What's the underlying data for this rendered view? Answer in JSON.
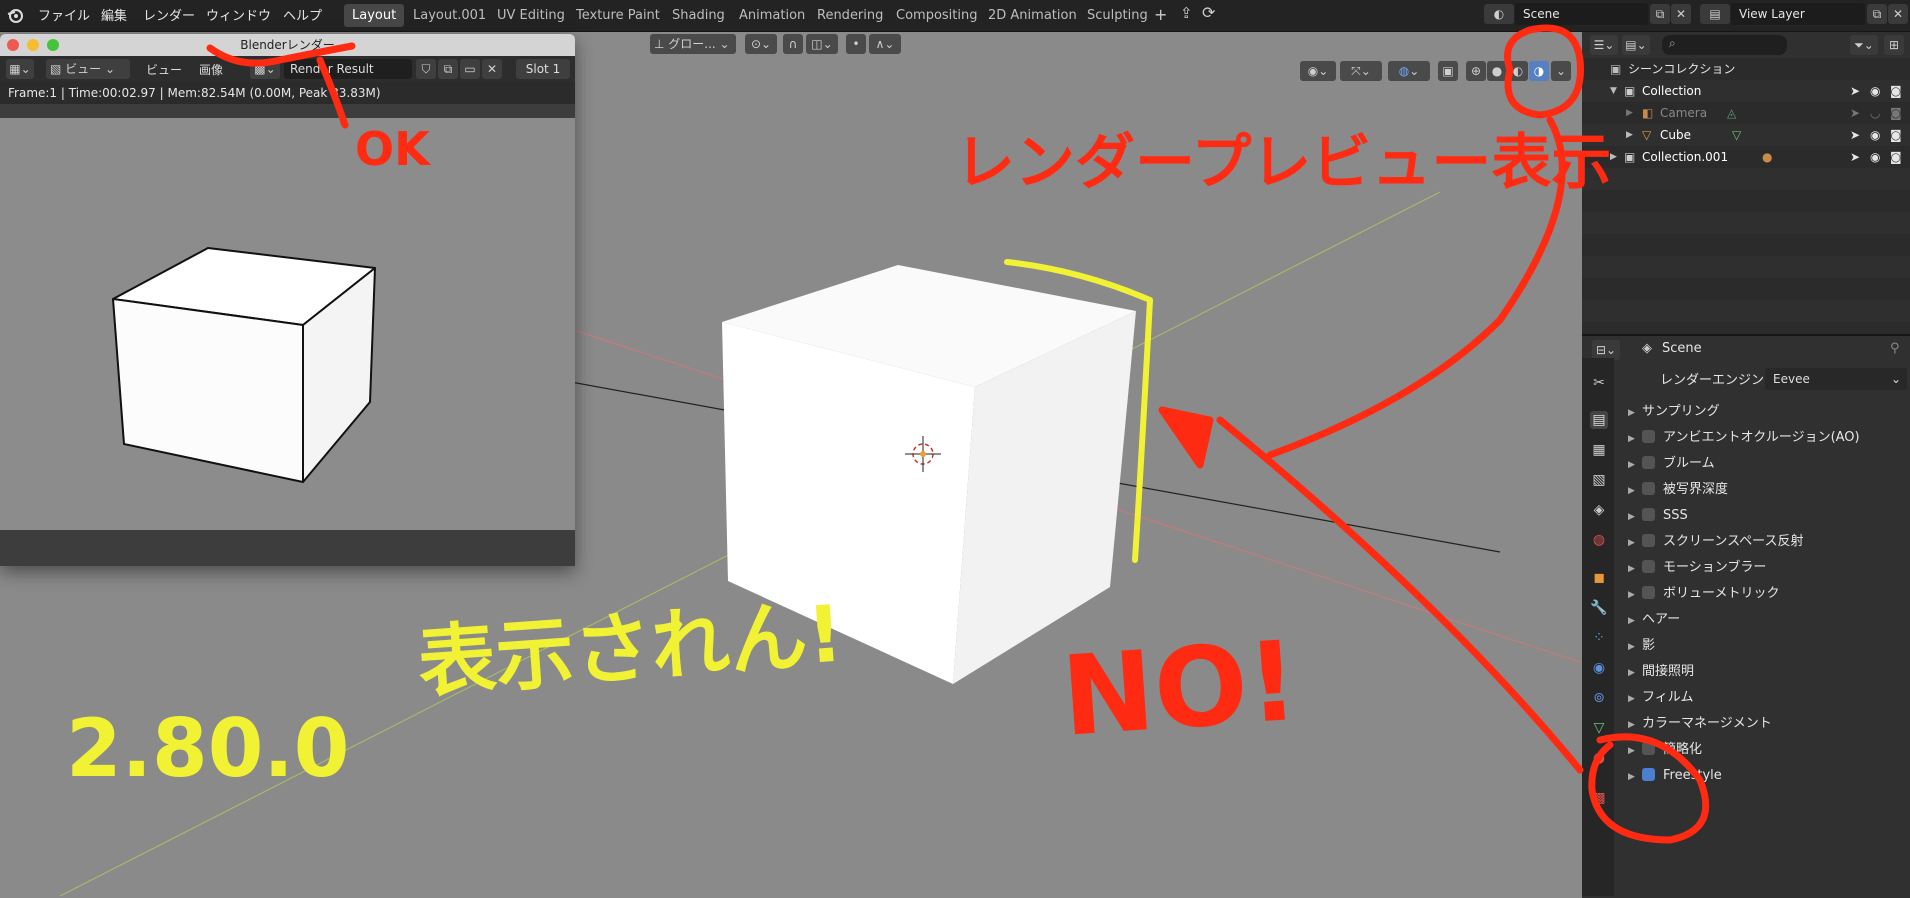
{
  "menu": [
    "ファイル",
    "編集",
    "レンダー",
    "ウィンドウ",
    "ヘルプ"
  ],
  "workspaces": [
    "Layout",
    "Layout.001",
    "UV Editing",
    "Texture Paint",
    "Shading",
    "Animation",
    "Rendering",
    "Compositing",
    "2D Animation",
    "Sculpting"
  ],
  "active_workspace": "Layout",
  "scene_name": "Scene",
  "view_layer": "View Layer",
  "viewport": {
    "orientation_label": "グロー...",
    "colors": {
      "bg": "#8a8a8a",
      "x_axis": "#d96b6b",
      "y_axis": "#9bb35a"
    }
  },
  "render_window": {
    "title": "Blenderレンダー",
    "toolbar": {
      "view1": "ビュー",
      "view2": "ビュー",
      "image": "画像",
      "result": "Render Result",
      "slot": "Slot 1"
    },
    "info": "Frame:1 | Time:00:02.97 | Mem:82.54M (0.00M, Peak 83.83M)"
  },
  "outliner": {
    "title": "シーンコレクション",
    "items": [
      {
        "label": "Collection",
        "dim": false
      },
      {
        "label": "Camera",
        "dim": true
      },
      {
        "label": "Cube",
        "dim": false
      },
      {
        "label": "Collection.001",
        "dim": false
      }
    ]
  },
  "properties": {
    "header": "Scene",
    "render_engine_label": "レンダーエンジン",
    "render_engine": "Eevee",
    "panels": [
      {
        "label": "サンプリング",
        "checkbox": null
      },
      {
        "label": "アンビエントオクルージョン(AO)",
        "checkbox": false
      },
      {
        "label": "ブルーム",
        "checkbox": false
      },
      {
        "label": "被写界深度",
        "checkbox": false
      },
      {
        "label": "SSS",
        "checkbox": false
      },
      {
        "label": "スクリーンスペース反射",
        "checkbox": false
      },
      {
        "label": "モーションブラー",
        "checkbox": false
      },
      {
        "label": "ボリューメトリック",
        "checkbox": false
      },
      {
        "label": "ヘアー",
        "checkbox": null
      },
      {
        "label": "影",
        "checkbox": null
      },
      {
        "label": "間接照明",
        "checkbox": null
      },
      {
        "label": "フィルム",
        "checkbox": null
      },
      {
        "label": "カラーマネージメント",
        "checkbox": null
      },
      {
        "label": "簡略化",
        "checkbox": false
      },
      {
        "label": "Freestyle",
        "checkbox": true
      }
    ]
  },
  "annotations": {
    "ok": "OK",
    "render_preview": "レンダープレビュー表示",
    "not_shown": "表示されん!",
    "no": "NO!",
    "version": "2.80.0",
    "colors": {
      "red": "#ff2a12",
      "yellow": "#f2f234"
    }
  }
}
